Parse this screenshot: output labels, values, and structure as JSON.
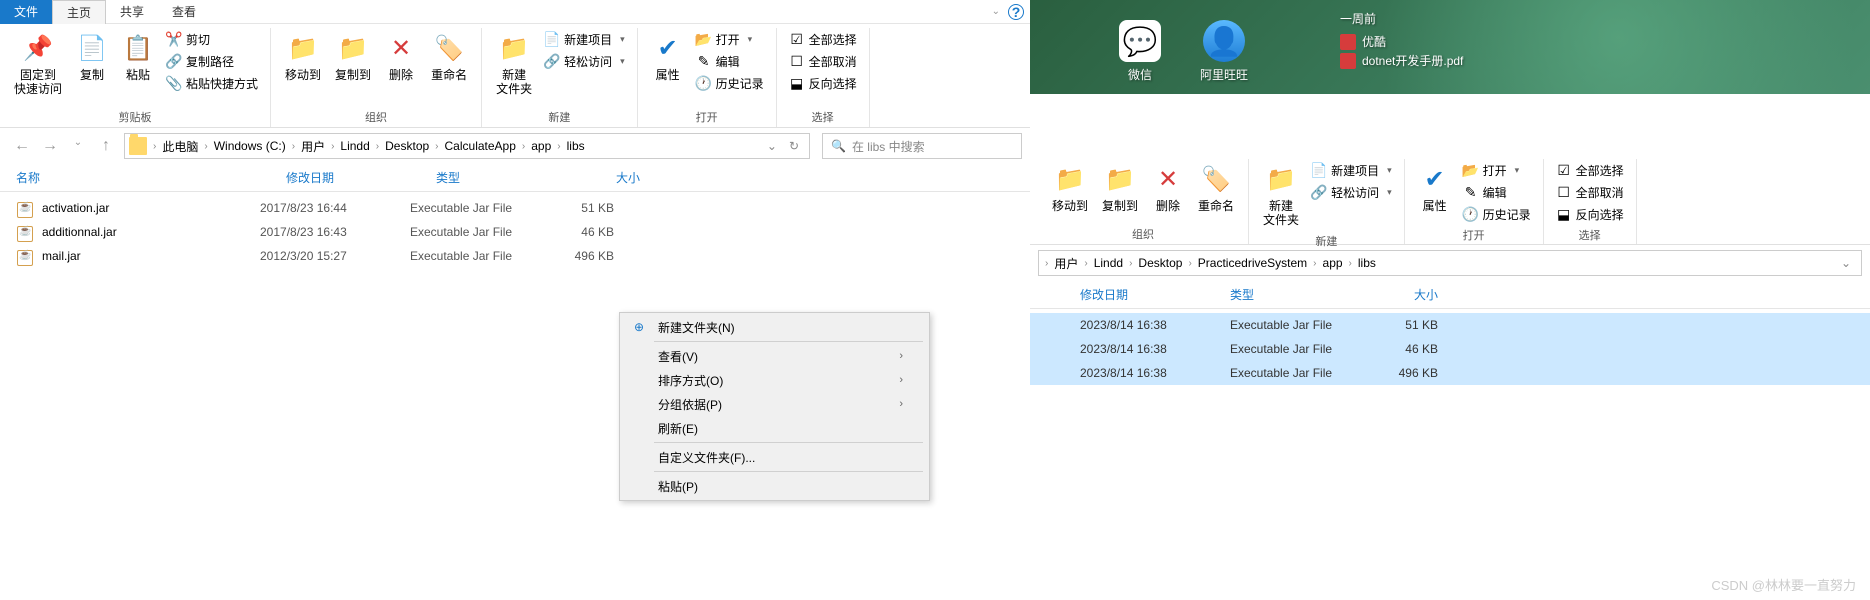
{
  "tabs": {
    "file": "文件",
    "home": "主页",
    "share": "共享",
    "view": "查看"
  },
  "ribbon": {
    "clipboard": {
      "label": "剪贴板",
      "pin": "固定到\n快速访问",
      "copy": "复制",
      "paste": "粘贴",
      "cut": "剪切",
      "copypath": "复制路径",
      "paste_shortcut": "粘贴快捷方式"
    },
    "organize": {
      "label": "组织",
      "moveto": "移动到",
      "copyto": "复制到",
      "delete": "删除",
      "rename": "重命名"
    },
    "new": {
      "label": "新建",
      "newfolder": "新建\n文件夹",
      "newitem": "新建项目",
      "easyaccess": "轻松访问"
    },
    "open": {
      "label": "打开",
      "properties": "属性",
      "open": "打开",
      "edit": "编辑",
      "history": "历史记录"
    },
    "select": {
      "label": "选择",
      "selectall": "全部选择",
      "selectnone": "全部取消",
      "invert": "反向选择"
    }
  },
  "breadcrumb": [
    "此电脑",
    "Windows  (C:)",
    "用户",
    "Lindd",
    "Desktop",
    "CalculateApp",
    "app",
    "libs"
  ],
  "search": {
    "placeholder": "在 libs 中搜索"
  },
  "columns": {
    "name": "名称",
    "date": "修改日期",
    "type": "类型",
    "size": "大小"
  },
  "files_left": [
    {
      "name": "activation.jar",
      "date": "2017/8/23 16:44",
      "type": "Executable Jar File",
      "size": "51 KB"
    },
    {
      "name": "additionnal.jar",
      "date": "2017/8/23 16:43",
      "type": "Executable Jar File",
      "size": "46 KB"
    },
    {
      "name": "mail.jar",
      "date": "2012/3/20 15:27",
      "type": "Executable Jar File",
      "size": "496 KB"
    }
  ],
  "context_menu": {
    "new_folder": "新建文件夹(N)",
    "view": "查看(V)",
    "sort": "排序方式(O)",
    "group": "分组依据(P)",
    "refresh": "刷新(E)",
    "customize": "自定义文件夹(F)...",
    "paste": "粘贴(P)"
  },
  "desktop": {
    "wechat": "微信",
    "aliww": "阿里旺旺",
    "week_ago": "一周前",
    "youku": "优酷",
    "pdf": "dotnet开发手册.pdf"
  },
  "breadcrumb_right": [
    "用户",
    "Lindd",
    "Desktop",
    "PracticedriveSystem",
    "app",
    "libs"
  ],
  "files_right": [
    {
      "date": "2023/8/14 16:38",
      "type": "Executable Jar File",
      "size": "51 KB"
    },
    {
      "date": "2023/8/14 16:38",
      "type": "Executable Jar File",
      "size": "46 KB"
    },
    {
      "date": "2023/8/14 16:38",
      "type": "Executable Jar File",
      "size": "496 KB"
    }
  ],
  "watermark": "CSDN @林林要一直努力"
}
